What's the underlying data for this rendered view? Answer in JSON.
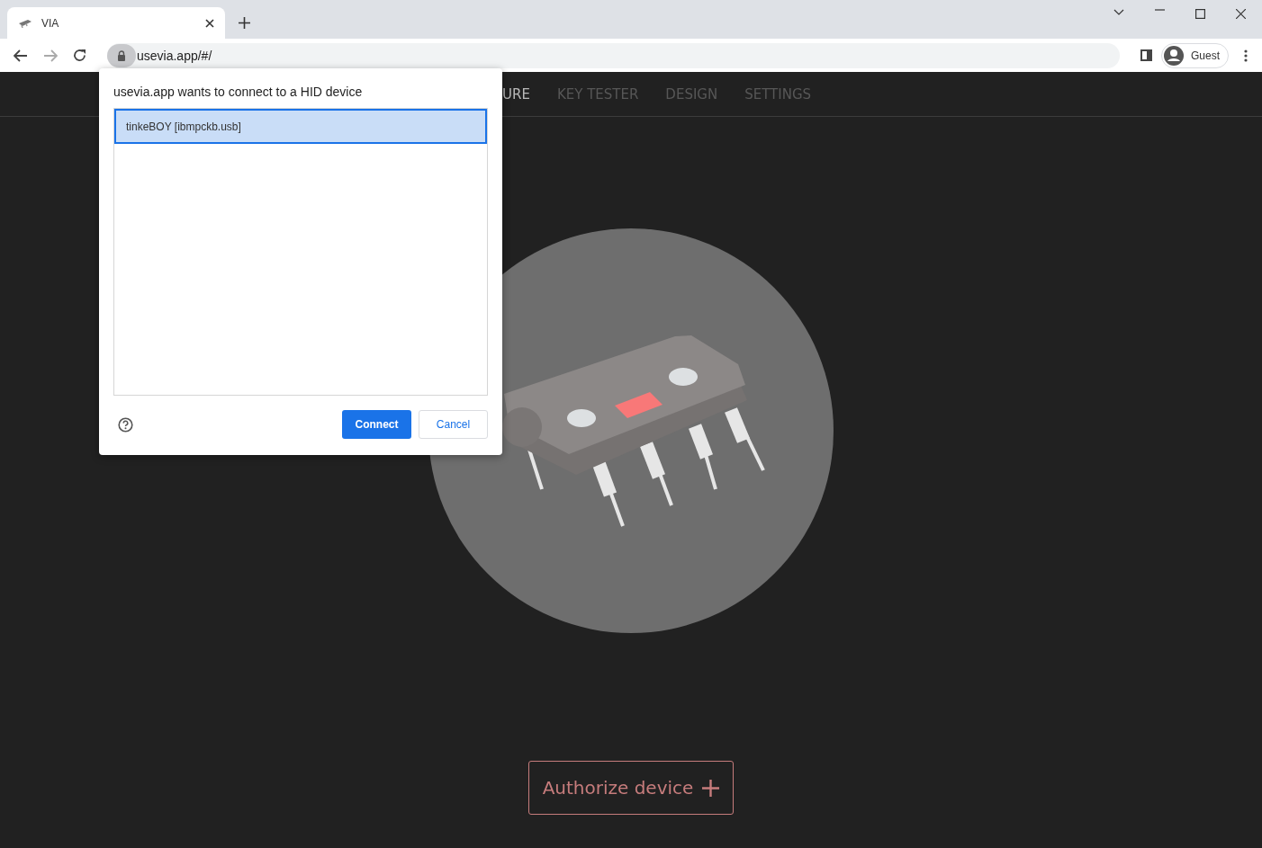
{
  "browser": {
    "tab": {
      "title": "VIA"
    },
    "address": "usevia.app/#/",
    "profile": "Guest"
  },
  "nav": [
    {
      "label": "URE",
      "selected": true
    },
    {
      "label": "KEY TESTER",
      "selected": false
    },
    {
      "label": "DESIGN",
      "selected": false
    },
    {
      "label": "SETTINGS",
      "selected": false
    }
  ],
  "dialog": {
    "title": "usevia.app wants to connect to a HID device",
    "devices": [
      {
        "name": "tinkeBOY [ibmpckb.usb]",
        "selected": true
      }
    ],
    "buttons": [
      {
        "label": "Connect",
        "kind": "primary"
      },
      {
        "label": "Cancel",
        "kind": "secondary"
      }
    ]
  },
  "authorize_button": "Authorize device"
}
